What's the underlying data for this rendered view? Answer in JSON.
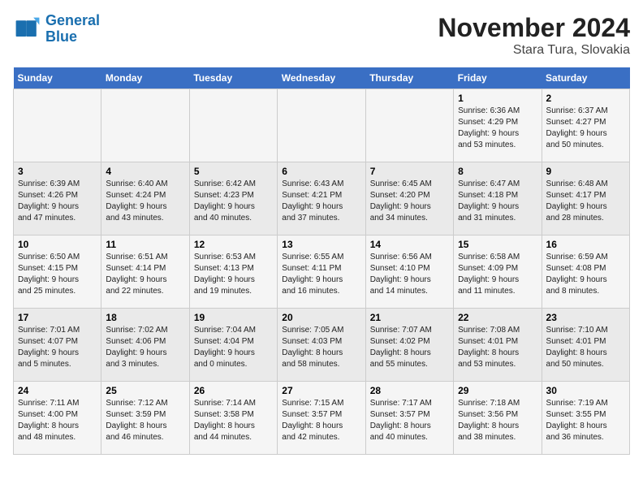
{
  "logo": {
    "line1": "General",
    "line2": "Blue"
  },
  "title": "November 2024",
  "subtitle": "Stara Tura, Slovakia",
  "days_of_week": [
    "Sunday",
    "Monday",
    "Tuesday",
    "Wednesday",
    "Thursday",
    "Friday",
    "Saturday"
  ],
  "weeks": [
    [
      {
        "day": "",
        "info": ""
      },
      {
        "day": "",
        "info": ""
      },
      {
        "day": "",
        "info": ""
      },
      {
        "day": "",
        "info": ""
      },
      {
        "day": "",
        "info": ""
      },
      {
        "day": "1",
        "info": "Sunrise: 6:36 AM\nSunset: 4:29 PM\nDaylight: 9 hours\nand 53 minutes."
      },
      {
        "day": "2",
        "info": "Sunrise: 6:37 AM\nSunset: 4:27 PM\nDaylight: 9 hours\nand 50 minutes."
      }
    ],
    [
      {
        "day": "3",
        "info": "Sunrise: 6:39 AM\nSunset: 4:26 PM\nDaylight: 9 hours\nand 47 minutes."
      },
      {
        "day": "4",
        "info": "Sunrise: 6:40 AM\nSunset: 4:24 PM\nDaylight: 9 hours\nand 43 minutes."
      },
      {
        "day": "5",
        "info": "Sunrise: 6:42 AM\nSunset: 4:23 PM\nDaylight: 9 hours\nand 40 minutes."
      },
      {
        "day": "6",
        "info": "Sunrise: 6:43 AM\nSunset: 4:21 PM\nDaylight: 9 hours\nand 37 minutes."
      },
      {
        "day": "7",
        "info": "Sunrise: 6:45 AM\nSunset: 4:20 PM\nDaylight: 9 hours\nand 34 minutes."
      },
      {
        "day": "8",
        "info": "Sunrise: 6:47 AM\nSunset: 4:18 PM\nDaylight: 9 hours\nand 31 minutes."
      },
      {
        "day": "9",
        "info": "Sunrise: 6:48 AM\nSunset: 4:17 PM\nDaylight: 9 hours\nand 28 minutes."
      }
    ],
    [
      {
        "day": "10",
        "info": "Sunrise: 6:50 AM\nSunset: 4:15 PM\nDaylight: 9 hours\nand 25 minutes."
      },
      {
        "day": "11",
        "info": "Sunrise: 6:51 AM\nSunset: 4:14 PM\nDaylight: 9 hours\nand 22 minutes."
      },
      {
        "day": "12",
        "info": "Sunrise: 6:53 AM\nSunset: 4:13 PM\nDaylight: 9 hours\nand 19 minutes."
      },
      {
        "day": "13",
        "info": "Sunrise: 6:55 AM\nSunset: 4:11 PM\nDaylight: 9 hours\nand 16 minutes."
      },
      {
        "day": "14",
        "info": "Sunrise: 6:56 AM\nSunset: 4:10 PM\nDaylight: 9 hours\nand 14 minutes."
      },
      {
        "day": "15",
        "info": "Sunrise: 6:58 AM\nSunset: 4:09 PM\nDaylight: 9 hours\nand 11 minutes."
      },
      {
        "day": "16",
        "info": "Sunrise: 6:59 AM\nSunset: 4:08 PM\nDaylight: 9 hours\nand 8 minutes."
      }
    ],
    [
      {
        "day": "17",
        "info": "Sunrise: 7:01 AM\nSunset: 4:07 PM\nDaylight: 9 hours\nand 5 minutes."
      },
      {
        "day": "18",
        "info": "Sunrise: 7:02 AM\nSunset: 4:06 PM\nDaylight: 9 hours\nand 3 minutes."
      },
      {
        "day": "19",
        "info": "Sunrise: 7:04 AM\nSunset: 4:04 PM\nDaylight: 9 hours\nand 0 minutes."
      },
      {
        "day": "20",
        "info": "Sunrise: 7:05 AM\nSunset: 4:03 PM\nDaylight: 8 hours\nand 58 minutes."
      },
      {
        "day": "21",
        "info": "Sunrise: 7:07 AM\nSunset: 4:02 PM\nDaylight: 8 hours\nand 55 minutes."
      },
      {
        "day": "22",
        "info": "Sunrise: 7:08 AM\nSunset: 4:01 PM\nDaylight: 8 hours\nand 53 minutes."
      },
      {
        "day": "23",
        "info": "Sunrise: 7:10 AM\nSunset: 4:01 PM\nDaylight: 8 hours\nand 50 minutes."
      }
    ],
    [
      {
        "day": "24",
        "info": "Sunrise: 7:11 AM\nSunset: 4:00 PM\nDaylight: 8 hours\nand 48 minutes."
      },
      {
        "day": "25",
        "info": "Sunrise: 7:12 AM\nSunset: 3:59 PM\nDaylight: 8 hours\nand 46 minutes."
      },
      {
        "day": "26",
        "info": "Sunrise: 7:14 AM\nSunset: 3:58 PM\nDaylight: 8 hours\nand 44 minutes."
      },
      {
        "day": "27",
        "info": "Sunrise: 7:15 AM\nSunset: 3:57 PM\nDaylight: 8 hours\nand 42 minutes."
      },
      {
        "day": "28",
        "info": "Sunrise: 7:17 AM\nSunset: 3:57 PM\nDaylight: 8 hours\nand 40 minutes."
      },
      {
        "day": "29",
        "info": "Sunrise: 7:18 AM\nSunset: 3:56 PM\nDaylight: 8 hours\nand 38 minutes."
      },
      {
        "day": "30",
        "info": "Sunrise: 7:19 AM\nSunset: 3:55 PM\nDaylight: 8 hours\nand 36 minutes."
      }
    ]
  ]
}
